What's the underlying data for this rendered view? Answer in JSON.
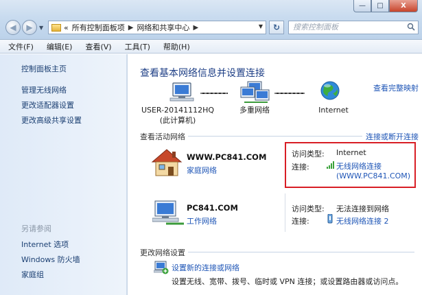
{
  "window": {
    "minimize": "—",
    "maximize": "□",
    "close": "X"
  },
  "address": {
    "chevron": "«",
    "crumb1": "所有控制面板项",
    "crumb2": "网络和共享中心",
    "search_placeholder": "搜索控制面板"
  },
  "menu": {
    "file": "文件(F)",
    "edit": "编辑(E)",
    "view": "查看(V)",
    "tools": "工具(T)",
    "help": "帮助(H)"
  },
  "sidebar": {
    "home": "控制面板主页",
    "manage_wireless": "管理无线网络",
    "adapter_settings": "更改适配器设置",
    "advanced_sharing": "更改高级共享设置",
    "see_also": "另请参阅",
    "internet_options": "Internet 选项",
    "firewall": "Windows 防火墙",
    "homegroup": "家庭组"
  },
  "main": {
    "heading": "查看基本网络信息并设置连接",
    "full_map": "查看完整映射",
    "computer_name": "USER-20141112HQ",
    "computer_sub": "(此计算机)",
    "multiple_networks": "多重网络",
    "internet": "Internet",
    "active_networks": "查看活动网络",
    "connect_disconnect": "连接或断开连接",
    "network1": {
      "name": "WWW.PC841.COM",
      "type": "家庭网络",
      "access_label": "访问类型:",
      "access_value": "Internet",
      "conn_label": "连接:",
      "conn_link1": "无线网络连接",
      "conn_link2": "(WWW.PC841.COM)"
    },
    "network2": {
      "name": "PC841.COM",
      "type": "工作网络",
      "access_label": "访问类型:",
      "access_value": "无法连接到网络",
      "conn_label": "连接:",
      "conn_link": "无线网络连接 2"
    },
    "change_settings": "更改网络设置",
    "new_connection": "设置新的连接或网络",
    "new_connection_desc": "设置无线、宽带、拨号、临时或 VPN 连接；或设置路由器或访问点。"
  },
  "colors": {
    "link": "#1e55b6",
    "heading": "#1e3f86",
    "highlight": "#d81d24",
    "sidebar_bg": "#dfeaf8"
  }
}
